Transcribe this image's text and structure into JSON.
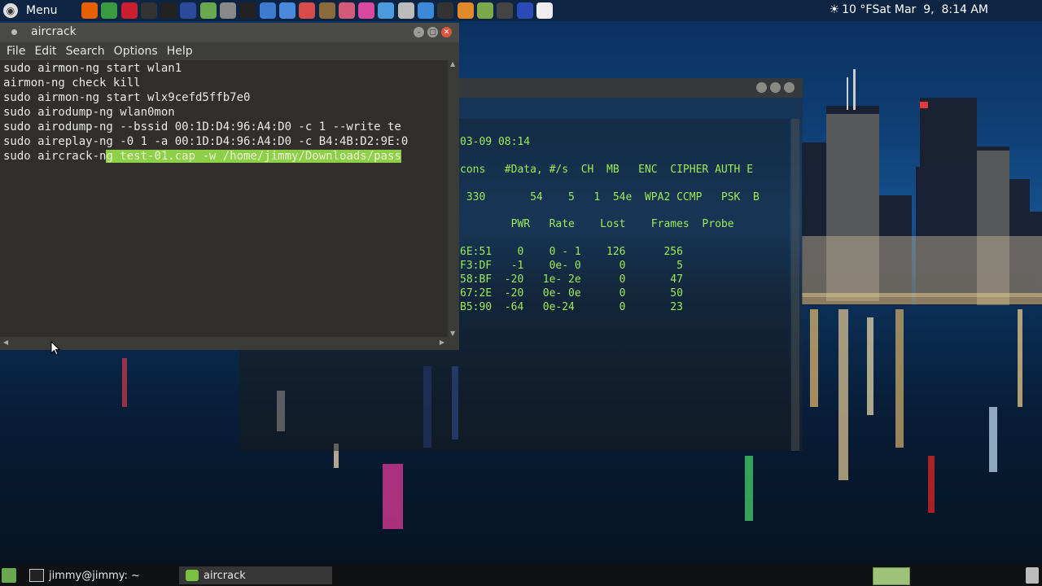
{
  "top_panel": {
    "menu_label": "Menu",
    "launchers": [
      {
        "icon": "firefox-icon",
        "color": "#e66000"
      },
      {
        "icon": "chrome-icon",
        "color": "#3a9a3f"
      },
      {
        "icon": "opera-icon",
        "color": "#cc1f2f"
      },
      {
        "icon": "dots-icon",
        "color": "#333333"
      },
      {
        "icon": "amazon-icon",
        "color": "#222222"
      },
      {
        "icon": "shield-icon",
        "color": "#2c4a9a"
      },
      {
        "icon": "folder-icon",
        "color": "#6aa84f"
      },
      {
        "icon": "info-icon",
        "color": "#888888"
      },
      {
        "icon": "terminal-icon",
        "color": "#222222"
      },
      {
        "icon": "settings-icon",
        "color": "#3d7bd1"
      },
      {
        "icon": "brush-icon",
        "color": "#4a89dc"
      },
      {
        "icon": "flag-icon",
        "color": "#d94a4a"
      },
      {
        "icon": "calculator-icon",
        "color": "#8a6a3a"
      },
      {
        "icon": "color-picker-icon",
        "color": "#d45a7a"
      },
      {
        "icon": "audio-icon",
        "color": "#d84aa0"
      },
      {
        "icon": "window-icon",
        "color": "#4a9adc"
      },
      {
        "icon": "spreadsheet-icon",
        "color": "#bbbbbb"
      },
      {
        "icon": "chart-icon",
        "color": "#3a8ad8"
      },
      {
        "icon": "monitor-icon",
        "color": "#333333"
      },
      {
        "icon": "sublime-icon",
        "color": "#e08a2a"
      },
      {
        "icon": "network-icon",
        "color": "#7aa84a"
      },
      {
        "icon": "bird-icon",
        "color": "#444444"
      },
      {
        "icon": "mfe-icon",
        "color": "#2a4ab8"
      },
      {
        "icon": "weather-cloud-icon",
        "color": "#eeeeee"
      }
    ],
    "weather": "10 °F",
    "datetime": "Sat Mar  9,  8:14 AM"
  },
  "back_window": {
    "lines": [
      {
        "text": "03-09 08:14"
      },
      {
        "text": "cons   #Data, #/s  CH  MB   ENC  CIPHER AUTH E"
      },
      {
        "text": " 330       54    5   1  54e  WPA2 CCMP   PSK  B"
      },
      {
        "text": "        PWR   Rate    Lost    Frames  Probe"
      },
      {
        "text": "6E:51    0    0 - 1    126      256"
      },
      {
        "text": "F3:DF   -1    0e- 0      0        5"
      },
      {
        "text": "58:BF  -20   1e- 2e      0       47"
      },
      {
        "text": "67:2E  -20   0e- 0e      0       50"
      },
      {
        "text": "B5:90  -64   0e-24       0       23"
      }
    ]
  },
  "front_window": {
    "title": "aircrack",
    "menu": [
      "File",
      "Edit",
      "Search",
      "Options",
      "Help"
    ],
    "lines": [
      "sudo airmon-ng start wlan1",
      "airmon-ng check kill",
      "sudo airmon-ng start wlx9cefd5ffb7e0",
      "sudo airodump-ng wlan0mon",
      "sudo airodump-ng --bssid 00:1D:D4:96:A4:D0 -c 1 --write te",
      "sudo aireplay-ng -0 1 -a 00:1D:D4:96:A4:D0 -c B4:4B:D2:9E:0"
    ],
    "last_line_plain": "sudo aircrack-n",
    "last_line_selected": "g test-01.cap -w /home/jimmy/Downloads/pass"
  },
  "bottom_panel": {
    "tasks": [
      {
        "label": "jimmy@jimmy: ~",
        "icon": "terminal-icon"
      },
      {
        "label": "aircrack",
        "icon": "text-editor-icon"
      }
    ]
  }
}
